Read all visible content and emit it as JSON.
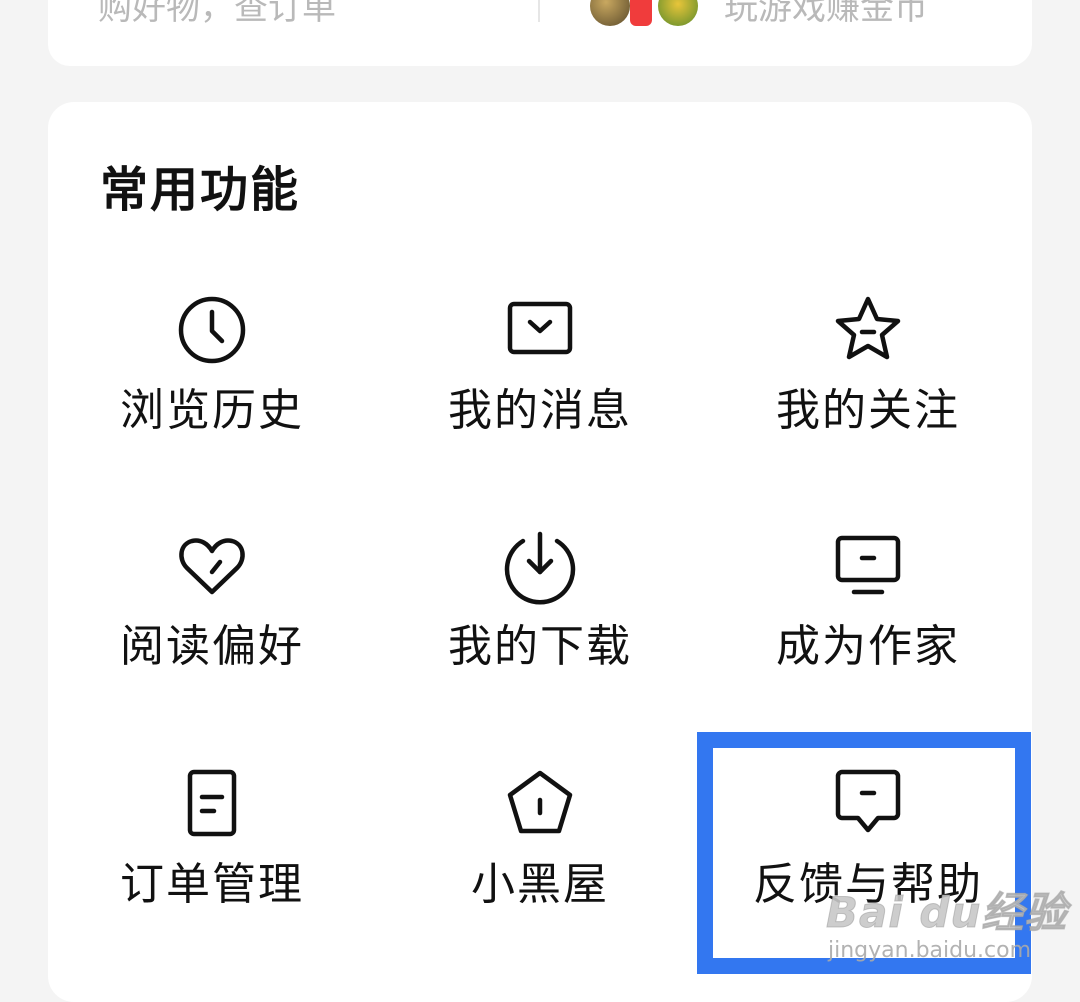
{
  "top_card": {
    "left_text": "购好物，查订单",
    "right_text": "玩游戏赚金币"
  },
  "section": {
    "title": "常用功能",
    "items": [
      {
        "label": "浏览历史",
        "icon": "clock-icon"
      },
      {
        "label": "我的消息",
        "icon": "message-box-icon"
      },
      {
        "label": "我的关注",
        "icon": "star-icon"
      },
      {
        "label": "阅读偏好",
        "icon": "heart-icon"
      },
      {
        "label": "我的下载",
        "icon": "download-icon"
      },
      {
        "label": "成为作家",
        "icon": "monitor-icon"
      },
      {
        "label": "订单管理",
        "icon": "document-icon"
      },
      {
        "label": "小黑屋",
        "icon": "pentagon-icon"
      },
      {
        "label": "反馈与帮助",
        "icon": "chat-bubble-icon"
      }
    ]
  },
  "highlight_color": "#3377f0",
  "watermark": {
    "brand": "Bai du经验",
    "url": "jingyan.baidu.com"
  }
}
